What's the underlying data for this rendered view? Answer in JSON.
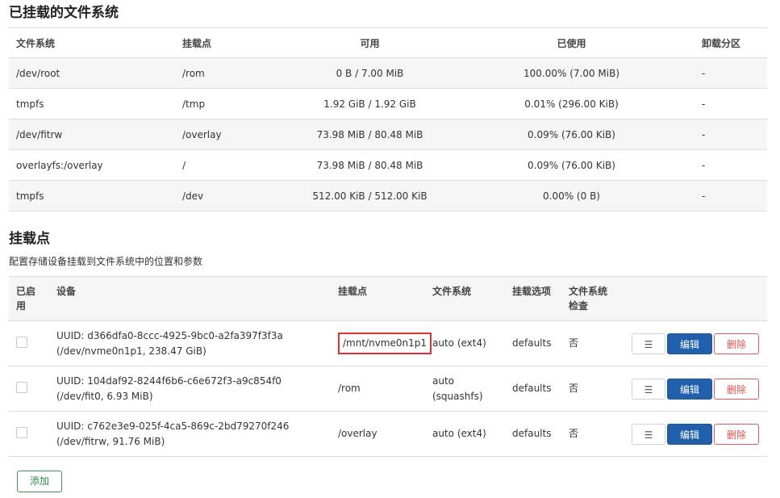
{
  "mounted_fs": {
    "title": "已挂载的文件系统",
    "headers": [
      "文件系统",
      "挂载点",
      "可用",
      "已使用",
      "卸载分区"
    ],
    "rows": [
      {
        "fs": "/dev/root",
        "mount": "/rom",
        "avail": "0 B / 7.00 MiB",
        "used": "100.00% (7.00 MiB)",
        "unmount": "-"
      },
      {
        "fs": "tmpfs",
        "mount": "/tmp",
        "avail": "1.92 GiB / 1.92 GiB",
        "used": "0.01% (296.00 KiB)",
        "unmount": "-"
      },
      {
        "fs": "/dev/fitrw",
        "mount": "/overlay",
        "avail": "73.98 MiB / 80.48 MiB",
        "used": "0.09% (76.00 KiB)",
        "unmount": "-"
      },
      {
        "fs": "overlayfs:/overlay",
        "mount": "/",
        "avail": "73.98 MiB / 80.48 MiB",
        "used": "0.09% (76.00 KiB)",
        "unmount": "-"
      },
      {
        "fs": "tmpfs",
        "mount": "/dev",
        "avail": "512.00 KiB / 512.00 KiB",
        "used": "0.00% (0 B)",
        "unmount": "-"
      }
    ]
  },
  "mount_points": {
    "title": "挂载点",
    "description": "配置存储设备挂载到文件系统中的位置和参数",
    "headers": {
      "enabled": "已启用",
      "device": "设备",
      "mount": "挂载点",
      "fs": "文件系统",
      "options": "挂载选项",
      "check": "文件系统检查"
    },
    "rows": [
      {
        "enabled": false,
        "device": "UUID: d366dfa0-8ccc-4925-9bc0-a2fa397f3f3a (/dev/nvme0n1p1, 238.47 GiB)",
        "mount": "/mnt/nvme0n1p1",
        "fs": "auto (ext4)",
        "options": "defaults",
        "check": "否"
      },
      {
        "enabled": false,
        "device": "UUID: 104daf92-8244f6b6-c6e672f3-a9c854f0 (/dev/fit0, 6.93 MiB)",
        "mount": "/rom",
        "fs": "auto (squashfs)",
        "options": "defaults",
        "check": "否"
      },
      {
        "enabled": false,
        "device": "UUID: c762e3e9-025f-4ca5-869c-2bd79270f246 (/dev/fitrw, 91.76 MiB)",
        "mount": "/overlay",
        "fs": "auto (ext4)",
        "options": "defaults",
        "check": "否"
      }
    ],
    "buttons": {
      "menu": "☰",
      "edit": "编辑",
      "delete": "删除"
    },
    "add_label": "添加"
  },
  "colors": {
    "primary": "#1f5fac",
    "danger": "#d9534f",
    "success": "#2f8a46",
    "highlight": "#e03131"
  }
}
